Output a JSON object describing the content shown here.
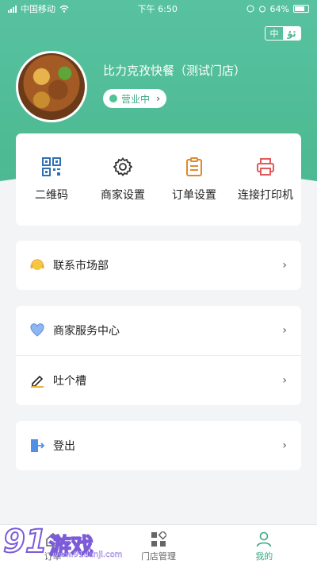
{
  "status_bar": {
    "carrier": "中国移动",
    "time": "下午 6:50",
    "battery": "64%"
  },
  "lang_toggle": {
    "zh": "中",
    "ug": "ئۇ"
  },
  "store": {
    "name": "比力克孜快餐（测试门店）",
    "status": "营业中"
  },
  "quick_actions": [
    {
      "label": "二维码",
      "icon": "qrcode-icon"
    },
    {
      "label": "商家设置",
      "icon": "gear-icon"
    },
    {
      "label": "订单设置",
      "icon": "clipboard-icon"
    },
    {
      "label": "连接打印机",
      "icon": "printer-icon"
    }
  ],
  "menu": {
    "market": {
      "label": "联系市场部",
      "icon": "headset-icon"
    },
    "service": {
      "label": "商家服务中心",
      "icon": "heart-shield-icon"
    },
    "feedback": {
      "label": "吐个槽",
      "icon": "pencil-icon"
    },
    "logout": {
      "label": "登出",
      "icon": "logout-icon"
    }
  },
  "tabbar": {
    "tab1": "订单",
    "tab2": "门店管理",
    "tab3": "我的"
  },
  "watermark": {
    "logo": "91",
    "text": "游戏",
    "url": "www.91danji.com"
  },
  "colors": {
    "brand": "#4cb992",
    "active_tab": "#3aa982"
  }
}
